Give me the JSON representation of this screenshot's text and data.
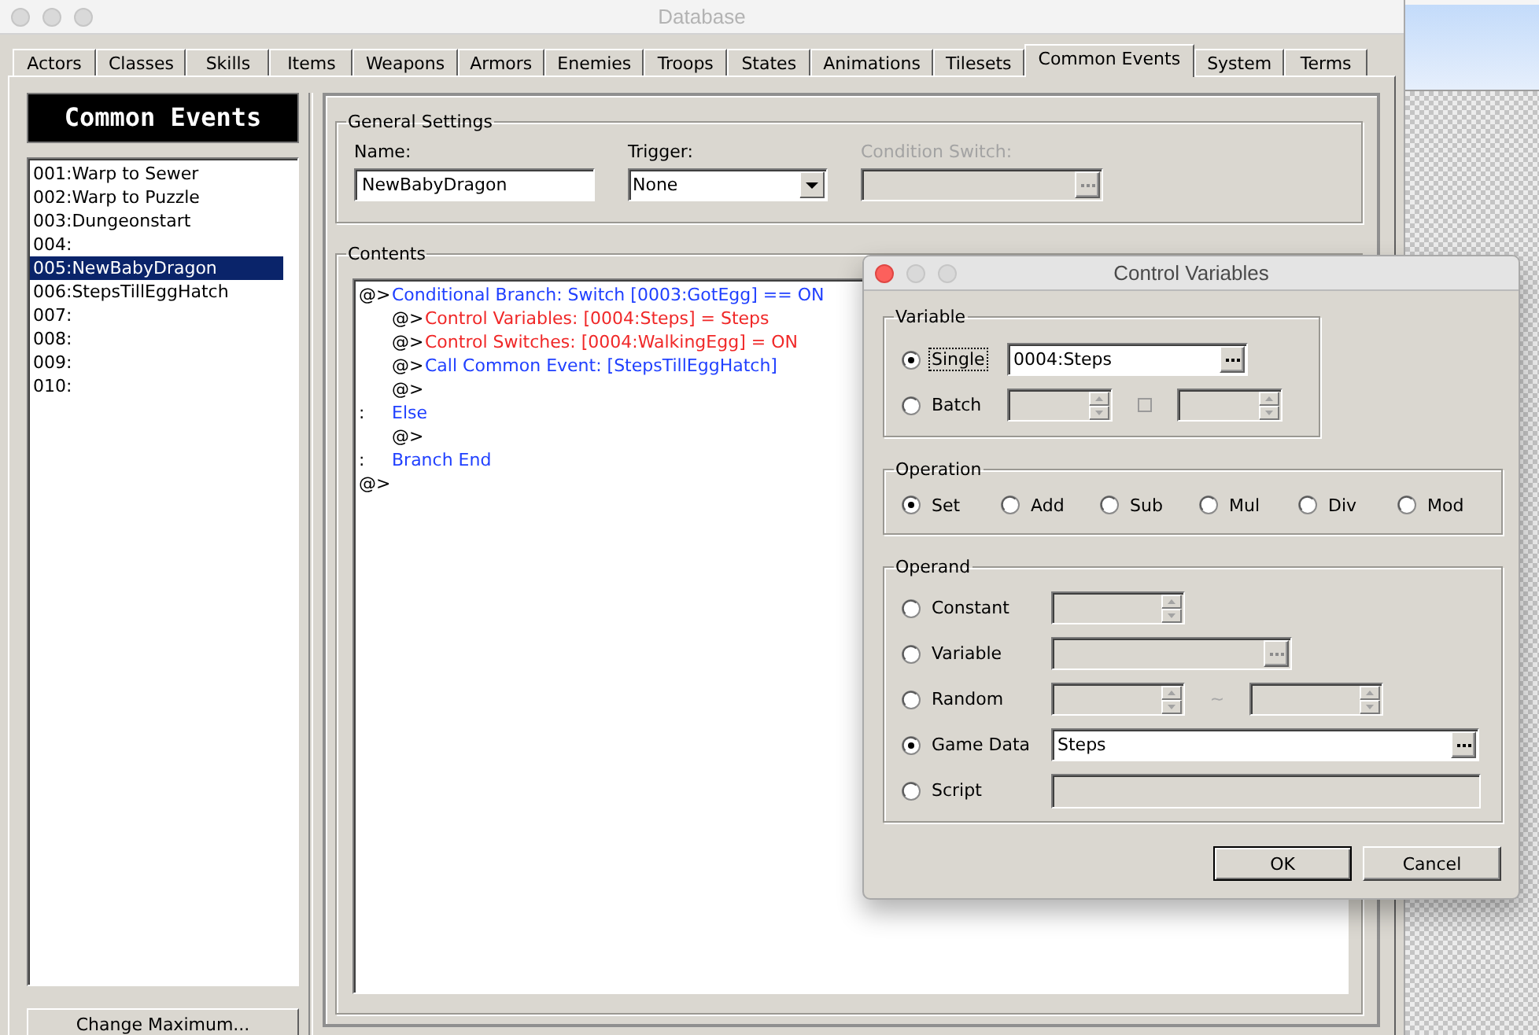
{
  "window": {
    "title": "Database",
    "active": false
  },
  "tabs": [
    {
      "label": "Actors",
      "selected": false
    },
    {
      "label": "Classes",
      "selected": false
    },
    {
      "label": "Skills",
      "selected": false
    },
    {
      "label": "Items",
      "selected": false
    },
    {
      "label": "Weapons",
      "selected": false
    },
    {
      "label": "Armors",
      "selected": false
    },
    {
      "label": "Enemies",
      "selected": false
    },
    {
      "label": "Troops",
      "selected": false
    },
    {
      "label": "States",
      "selected": false
    },
    {
      "label": "Animations",
      "selected": false
    },
    {
      "label": "Tilesets",
      "selected": false
    },
    {
      "label": "Common Events",
      "selected": true
    },
    {
      "label": "System",
      "selected": false
    },
    {
      "label": "Terms",
      "selected": false
    }
  ],
  "sidebar": {
    "header": "Common Events",
    "items": [
      {
        "label": "001:Warp to Sewer",
        "selected": false
      },
      {
        "label": "002:Warp to Puzzle",
        "selected": false
      },
      {
        "label": "003:Dungeonstart",
        "selected": false
      },
      {
        "label": "004:",
        "selected": false
      },
      {
        "label": "005:NewBabyDragon",
        "selected": true
      },
      {
        "label": "006:StepsTillEggHatch",
        "selected": false
      },
      {
        "label": "007:",
        "selected": false
      },
      {
        "label": "008:",
        "selected": false
      },
      {
        "label": "009:",
        "selected": false
      },
      {
        "label": "010:",
        "selected": false
      }
    ],
    "button": "Change Maximum..."
  },
  "general_settings": {
    "title": "General Settings",
    "name": {
      "label": "Name:",
      "value": "NewBabyDragon"
    },
    "trigger": {
      "label": "Trigger:",
      "value": "None"
    },
    "condition_switch": {
      "label": "Condition Switch:",
      "disabled": true
    }
  },
  "contents": {
    "title": "Contents",
    "lines": [
      {
        "prefix": "@>",
        "text": "Conditional Branch: Switch [0003:GotEgg] == ON",
        "color": "#2040ff",
        "children": [
          {
            "prefix": "@>",
            "text": "Control Variables: [0004:Steps] = Steps",
            "color": "#f02828"
          },
          {
            "prefix": "@>",
            "text": "Control Switches: [0004:WalkingEgg] = ON",
            "color": "#f02828"
          },
          {
            "prefix": "@>",
            "text": "Call Common Event: [StepsTillEggHatch]",
            "color": "#2040ff"
          },
          {
            "prefix": "@>"
          }
        ]
      },
      {
        "prefix": ":",
        "text": "Else",
        "color": "#2040ff",
        "children": [
          {
            "prefix": "@>"
          }
        ]
      },
      {
        "prefix": ":",
        "text": "Branch End",
        "color": "#2040ff"
      },
      {
        "prefix": "@>"
      }
    ]
  },
  "dialog": {
    "title": "Control Variables",
    "active": true,
    "variable": {
      "title": "Variable",
      "options": [
        {
          "label": "Single",
          "selected": true,
          "focused": true,
          "kind": "picker",
          "value": "0004:Steps"
        },
        {
          "label": "Batch",
          "selected": false,
          "focused": false,
          "kind": "range",
          "checkbox": {
            "checked": false
          }
        }
      ]
    },
    "operation": {
      "title": "Operation",
      "options": [
        {
          "label": "Set",
          "selected": true
        },
        {
          "label": "Add",
          "selected": false
        },
        {
          "label": "Sub",
          "selected": false
        },
        {
          "label": "Mul",
          "selected": false
        },
        {
          "label": "Div",
          "selected": false
        },
        {
          "label": "Mod",
          "selected": false
        }
      ]
    },
    "operand": {
      "title": "Operand",
      "options": [
        {
          "label": "Constant",
          "selected": false,
          "kind": "spinner"
        },
        {
          "label": "Variable",
          "selected": false,
          "kind": "picker"
        },
        {
          "label": "Random",
          "selected": false,
          "kind": "range",
          "separator": "~"
        },
        {
          "label": "Game Data",
          "selected": true,
          "kind": "picker",
          "value": "Steps"
        },
        {
          "label": "Script",
          "selected": false,
          "kind": "text"
        }
      ]
    },
    "buttons": [
      {
        "label": "OK",
        "default": true
      },
      {
        "label": "Cancel",
        "default": false
      }
    ]
  }
}
